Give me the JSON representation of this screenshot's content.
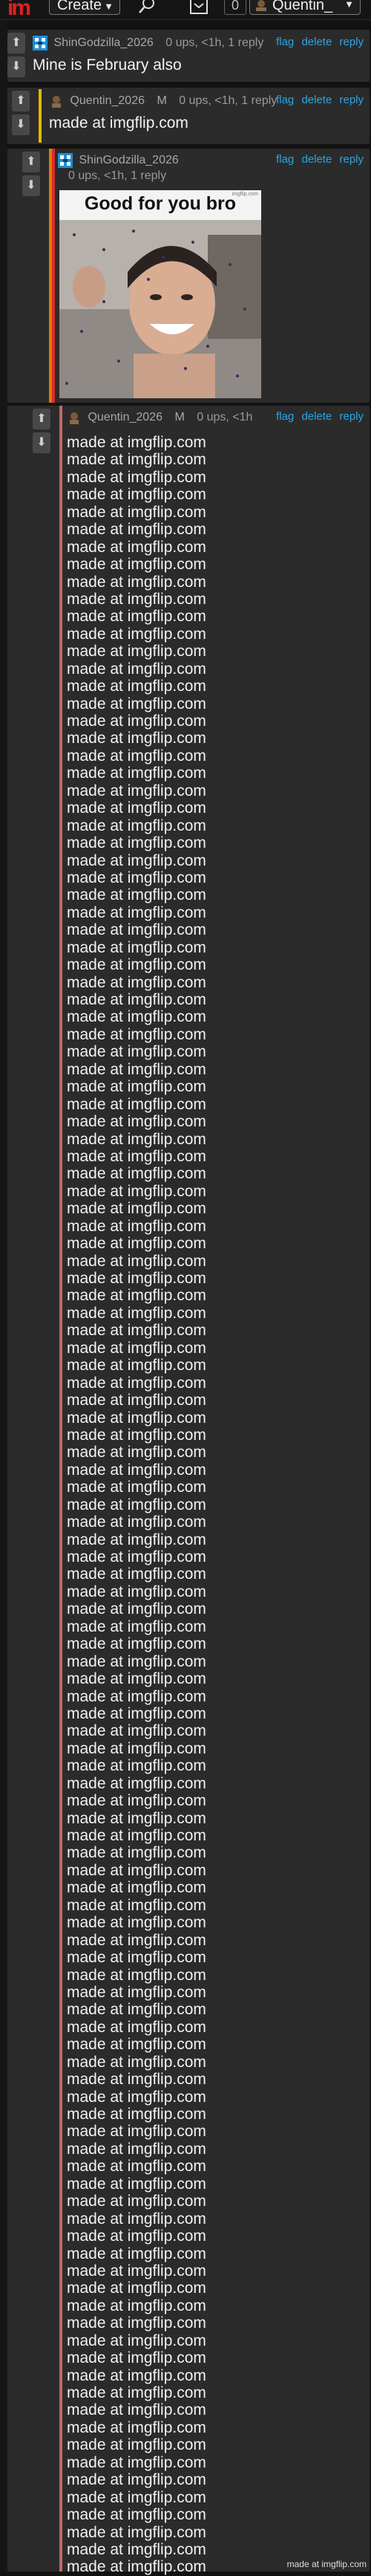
{
  "header": {
    "logo_text": "im",
    "create_label": "Create",
    "notification_count": "0",
    "username": "Quentin_"
  },
  "colors": {
    "background": "#121212",
    "comment_bg": "#2b2b2b",
    "link": "#2ba6e0",
    "bar_yellow": "#e6b800",
    "bar_orange": "#e07b00",
    "bar_red": "#d92b2b",
    "bar_pink": "#c06a6a"
  },
  "comments": [
    {
      "username": "ShinGodzilla_2026",
      "meta": "0 ups, <1h, 1 reply",
      "text": "Mine is February also",
      "actions": [
        "flag",
        "delete",
        "reply"
      ]
    },
    {
      "username": "Quentin_2026",
      "mod_badge": "M",
      "meta": "0 ups, <1h, 1 reply",
      "text": "made at imgflip.com",
      "actions": [
        "flag",
        "delete",
        "reply"
      ]
    },
    {
      "username": "ShinGodzilla_2026",
      "meta": "0 ups, <1h, 1 reply",
      "meme_caption": "Good for you bro",
      "meme_watermark": "imgflip.com",
      "actions": [
        "flag",
        "delete",
        "reply"
      ]
    },
    {
      "username": "Quentin_2026",
      "mod_badge": "M",
      "meta": "0 ups, <1h",
      "actions": [
        "flag",
        "delete",
        "reply"
      ],
      "repeated_line": "made at imgflip.com",
      "repeat_count": 123
    }
  ],
  "footer_watermark": "made at imgflip.com"
}
